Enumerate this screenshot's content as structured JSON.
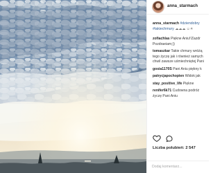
{
  "post": {
    "username": "anna_starmach",
    "caption": {
      "user": "anna_starmach",
      "hashtags": [
        "#dziendobry",
        "#takiechmury"
      ]
    }
  },
  "comments": [
    {
      "user": "zofiachlas",
      "text": " Piękne Aniu!!Zazdr"
    },
    {
      "user": "",
      "text": "Pozdraeiam;))"
    },
    {
      "user": "tomaszkar",
      "text": " Takie chmury wróżą"
    },
    {
      "user": "",
      "text": "tego życzę jak i również samych"
    },
    {
      "user": "",
      "text": "chwil zawsze uśmiechniętej Pani"
    },
    {
      "user": "gosia1170S",
      "text": " Pani Aniu piękny k"
    },
    {
      "user": "patrycjapochopien",
      "text": " Widok jak"
    },
    {
      "user": "stay_positive_life",
      "text": " Piękne"
    },
    {
      "user": "renifer6k71",
      "text": " Cudowna podróż"
    },
    {
      "user": "",
      "text": "życzę Pani Aniu"
    }
  ],
  "actions": {
    "like_icon": "heart-icon",
    "comment_icon": "comment-icon"
  },
  "likes_text": "Liczba polubień: 2 547",
  "date_text": "",
  "comment_input": {
    "placeholder": "Dodaj komentarz..."
  }
}
